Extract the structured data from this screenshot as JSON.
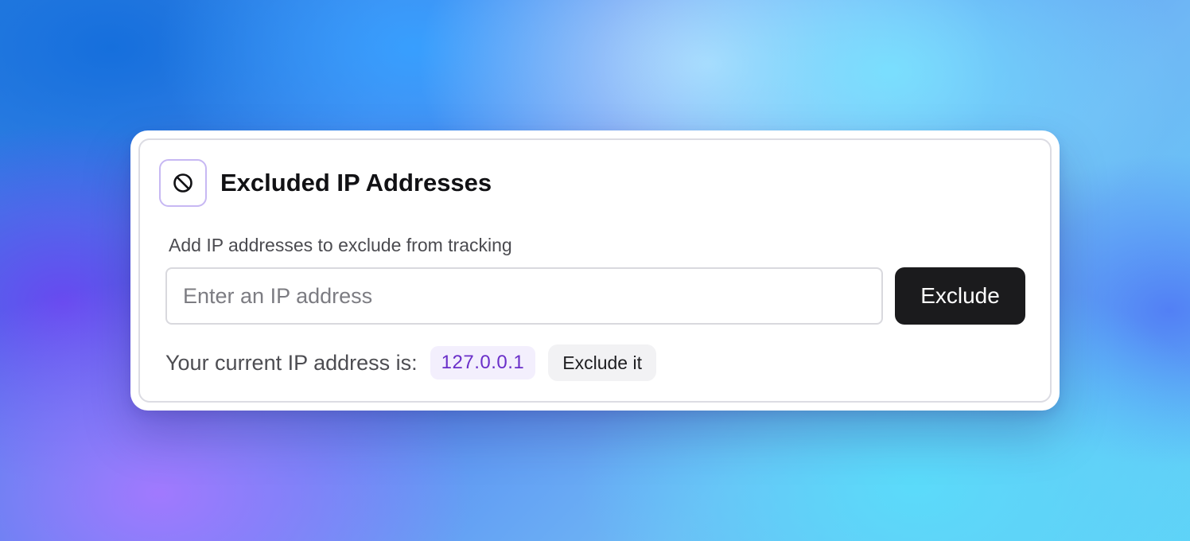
{
  "card": {
    "title": "Excluded IP Addresses",
    "icon": "ban-icon",
    "field_label": "Add IP addresses to exclude from tracking",
    "input": {
      "placeholder": "Enter an IP address",
      "value": ""
    },
    "exclude_button_label": "Exclude",
    "current_ip": {
      "label": "Your current IP address is:",
      "value": "127.0.0.1",
      "exclude_it_label": "Exclude it"
    }
  },
  "colors": {
    "accent_purple": "#6a2fc9",
    "icon_border": "#c7b8f3",
    "primary_button": "#1b1b1d"
  }
}
